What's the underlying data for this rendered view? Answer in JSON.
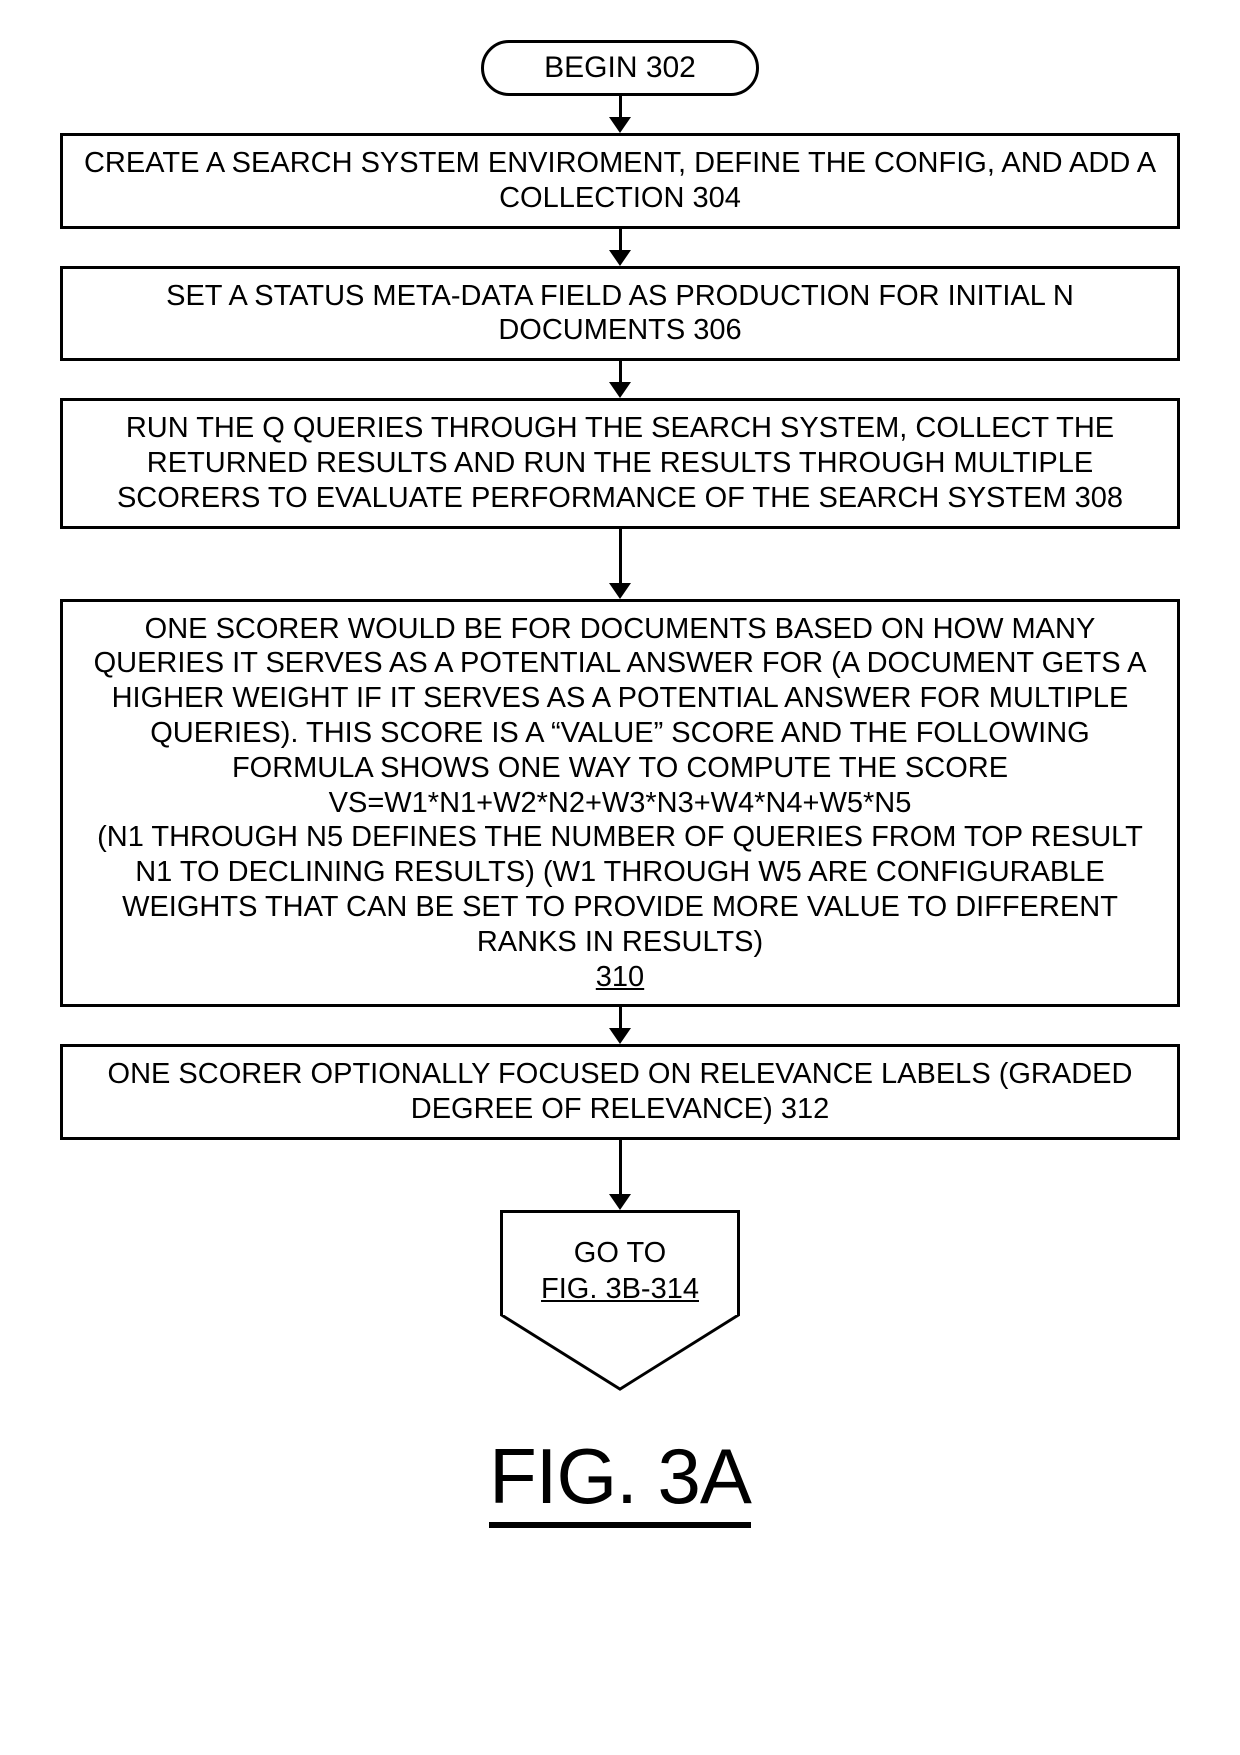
{
  "flowchart": {
    "start": "BEGIN 302",
    "step1": "CREATE A SEARCH SYSTEM ENVIROMENT, DEFINE THE CONFIG, AND ADD A COLLECTION 304",
    "step2": "SET A STATUS META-DATA FIELD AS PRODUCTION FOR INITIAL N DOCUMENTS 306",
    "step3": "RUN THE Q QUERIES THROUGH THE SEARCH SYSTEM, COLLECT THE RETURNED RESULTS AND RUN THE RESULTS THROUGH MULTIPLE SCORERS TO EVALUATE PERFORMANCE OF THE SEARCH SYSTEM  308",
    "step4_line1": "ONE SCORER WOULD BE FOR DOCUMENTS BASED ON HOW MANY QUERIES IT SERVES AS A POTENTIAL ANSWER FOR (A DOCUMENT GETS A HIGHER WEIGHT IF IT SERVES AS A POTENTIAL ANSWER FOR MULTIPLE QUERIES). THIS SCORE IS A “VALUE” SCORE AND THE FOLLOWING FORMULA SHOWS ONE WAY TO COMPUTE THE SCORE",
    "step4_formula": "VS=W1*N1+W2*N2+W3*N3+W4*N4+W5*N5",
    "step4_line2": "(N1 THROUGH N5 DEFINES THE NUMBER OF QUERIES FROM TOP RESULT N1 TO DECLINING RESULTS) (W1 THROUGH W5 ARE CONFIGURABLE WEIGHTS THAT CAN BE SET TO PROVIDE MORE VALUE TO DIFFERENT RANKS IN RESULTS)",
    "step4_ref": "310",
    "step5": "ONE SCORER OPTIONALLY FOCUSED ON RELEVANCE LABELS (GRADED DEGREE OF RELEVANCE) 312",
    "offpage_goto": "GO TO",
    "offpage_link": "FIG. 3B-314"
  },
  "caption": "FIG. 3A"
}
